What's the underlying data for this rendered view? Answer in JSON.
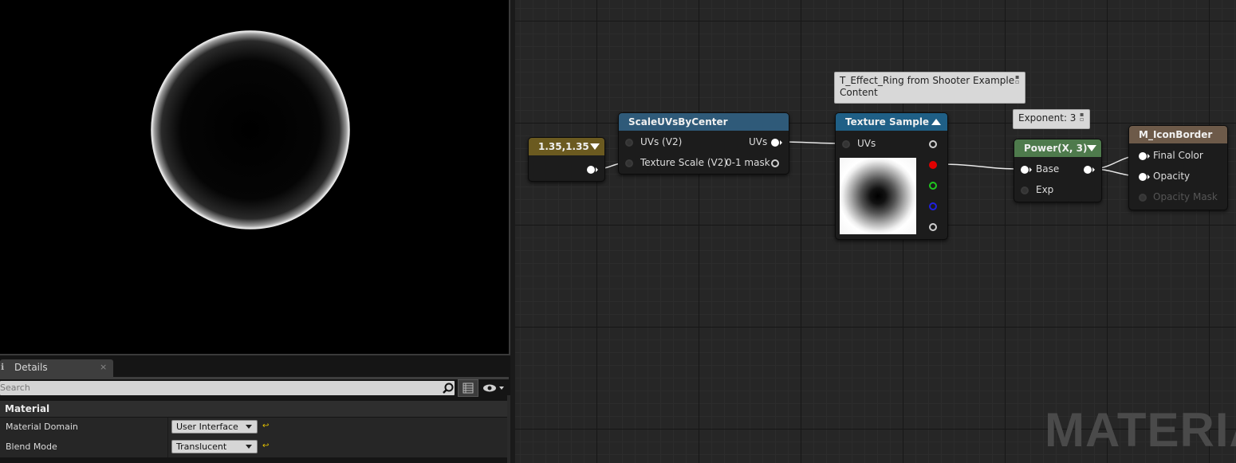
{
  "details": {
    "tab_label": "Details",
    "tab_close": "×",
    "search_placeholder": "Search",
    "category": "Material",
    "properties": [
      {
        "name": "Material Domain",
        "value": "User Interface"
      },
      {
        "name": "Blend Mode",
        "value": "Translucent"
      }
    ]
  },
  "graph": {
    "watermark": "MATERIAL",
    "constant_node": {
      "title": "1.35,1.35"
    },
    "scale_uvs_node": {
      "title": "ScaleUVsByCenter",
      "inputs": [
        "UVs (V2)",
        "Texture Scale (V2)"
      ],
      "outputs": [
        "UVs",
        "0-1 mask"
      ]
    },
    "texture_node": {
      "title": "Texture Sample",
      "comment": "T_Effect_Ring from Shooter Example Content",
      "input": "UVs"
    },
    "power_node": {
      "title": "Power(X, 3)",
      "comment": "Exponent: 3",
      "inputs": [
        "Base",
        "Exp"
      ]
    },
    "output_node": {
      "title": "M_IconBorder",
      "inputs": [
        "Final Color",
        "Opacity",
        "Opacity Mask"
      ]
    }
  },
  "colors": {
    "constant_header": "#6b5a20",
    "scale_header": "#2f5a79",
    "texture_header": "#1f5f86",
    "power_header": "#4e7a4c",
    "output_header": "#6d5a49"
  }
}
